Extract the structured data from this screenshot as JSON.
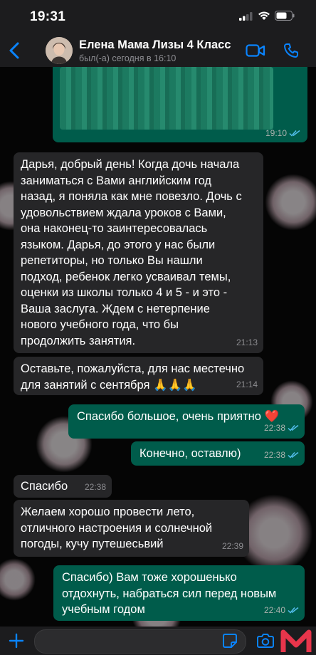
{
  "status_bar": {
    "time": "19:31"
  },
  "header": {
    "contact_name": "Елена Мама Лизы 4 Класс",
    "last_seen": "был(-а) сегодня в 16:10"
  },
  "messages": [
    {
      "direction": "out",
      "text": "",
      "time": "19:10",
      "read": true
    },
    {
      "direction": "in",
      "text": "Дарья, добрый день!  Когда дочь начала\nзаниматься с Вами английским год\nназад, я поняла как мне повезло. Дочь с\nудовольствием ждала уроков с Вами,\nона наконец-то заинтересовалась\nязыком. Дарья, до этого у нас были\nрепетиторы, но только Вы нашли\nподход, ребенок легко усваивал темы,\nоценки из школы только 4 и 5 - и это -\nВаша заслуга. Ждем с нетерпение\nнового учебного года, что бы\nпродолжить занятия.",
      "time": "21:13"
    },
    {
      "direction": "in",
      "text": "Оставьте, пожалуйста, для нас местечно\nдля занятий с сентября 🙏🙏🙏",
      "time": "21:14"
    },
    {
      "direction": "out",
      "text": "Спасибо большое, очень приятно ❤️",
      "time": "22:38",
      "read": true
    },
    {
      "direction": "out",
      "text": "Конечно, оставлю)",
      "time": "22:38",
      "read": true
    },
    {
      "direction": "in",
      "text": "Спасибо",
      "time": "22:38"
    },
    {
      "direction": "in",
      "text": "Желаем хорошо провести лето,\nотличного настроения и солнечной\nпогоды, кучу путешесьвий",
      "time": "22:39"
    },
    {
      "direction": "out",
      "text": "Спасибо) Вам тоже хорошенько\nотдохнуть, набраться сил перед новым\nучебным годом",
      "time": "22:40",
      "read": true
    }
  ],
  "colors": {
    "outgoing_bubble": "#005c4b",
    "incoming_bubble": "#262628",
    "accent": "#0a84ff",
    "read_ticks": "#53bdeb"
  },
  "icons": {
    "back": "chevron-left-icon",
    "video": "video-call-icon",
    "call": "phone-icon",
    "attach": "plus-icon",
    "sticker": "sticker-icon",
    "camera": "camera-icon",
    "watermark": "m-logo"
  }
}
